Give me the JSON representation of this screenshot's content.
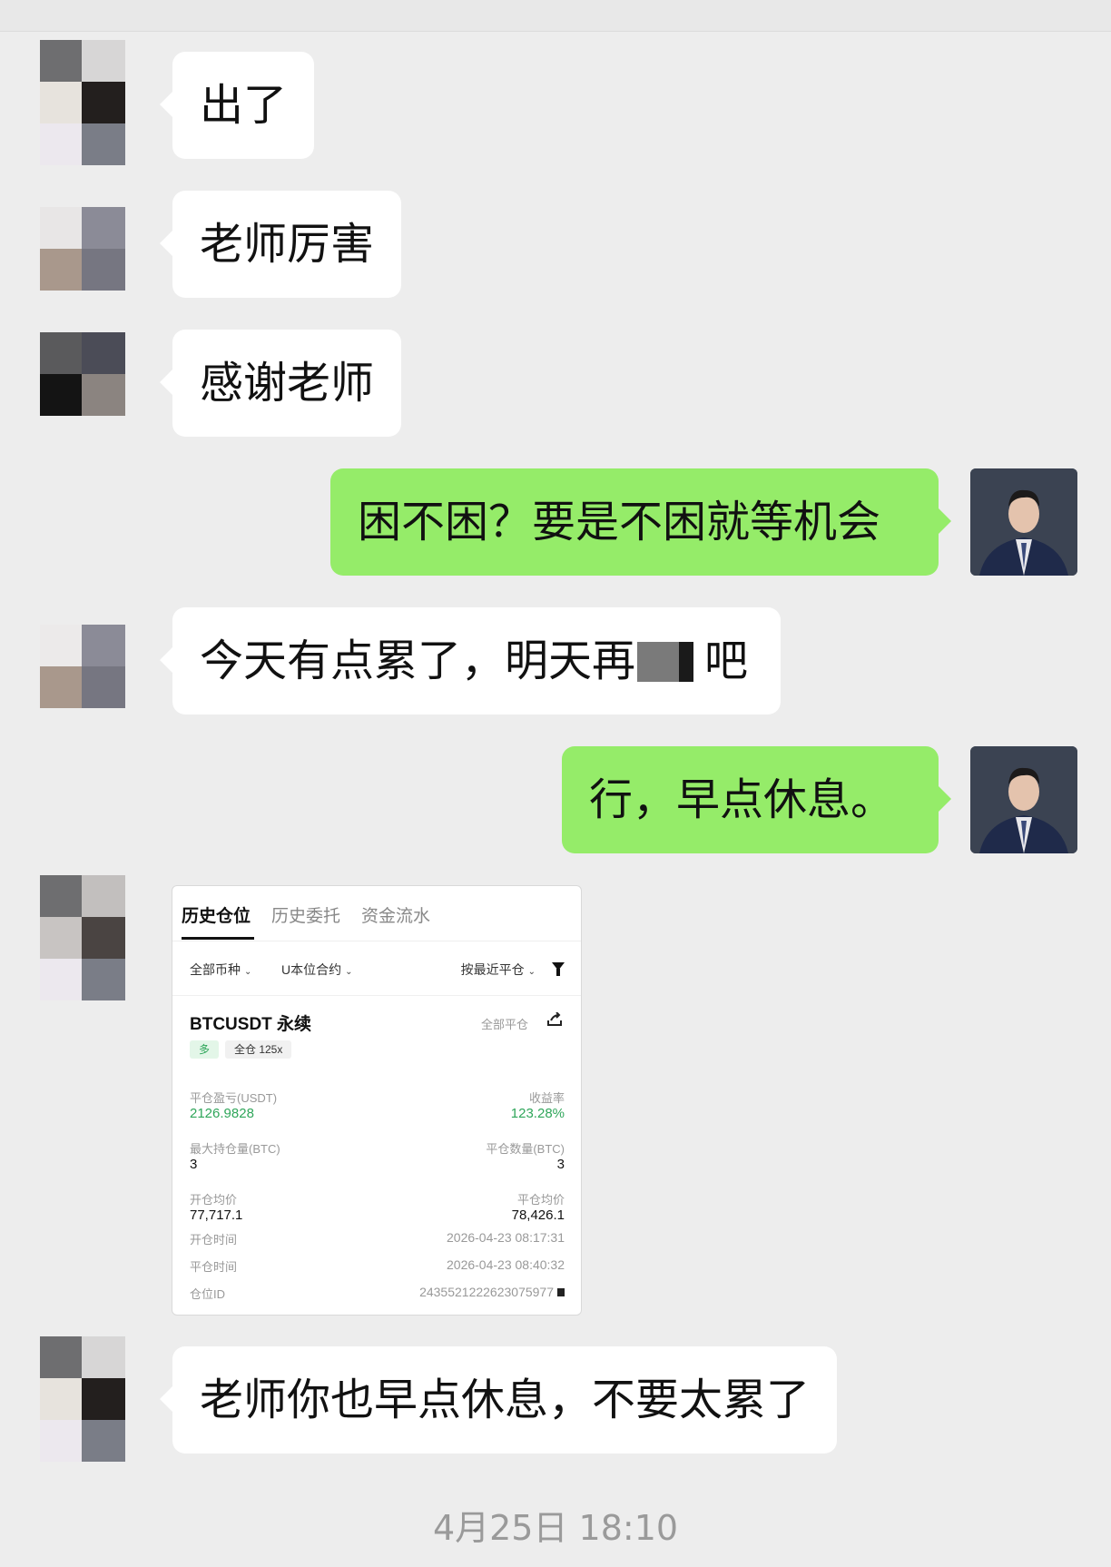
{
  "messages": [
    {
      "side": "left",
      "text": "出了"
    },
    {
      "side": "left",
      "text": "老师厉害"
    },
    {
      "side": "left",
      "text": "感谢老师"
    },
    {
      "side": "right",
      "text": "困不困？要是不困就等机会"
    },
    {
      "side": "left",
      "text_before": "今天有点累了，明天再",
      "text_after": "吧"
    },
    {
      "side": "right",
      "text": "行，早点休息。"
    },
    {
      "side": "left",
      "text": "老师你也早点休息，不要太累了"
    }
  ],
  "trade_card": {
    "tabs": [
      "历史仓位",
      "历史委托",
      "资金流水"
    ],
    "filters": {
      "coin": "全部币种",
      "contract": "U本位合约",
      "sort": "按最近平仓"
    },
    "symbol": "BTCUSDT 永续",
    "close_all": "全部平仓",
    "side_tag": "多",
    "mode_tag": "全仓 125x",
    "pnl_label": "平仓盈亏(USDT)",
    "pnl_value": "2126.9828",
    "roi_label": "收益率",
    "roi_value": "123.28%",
    "max_pos_label": "最大持仓量(BTC)",
    "max_pos_value": "3",
    "close_qty_label": "平仓数量(BTC)",
    "close_qty_value": "3",
    "open_avg_label": "开仓均价",
    "open_avg_value": "77,717.1",
    "close_avg_label": "平仓均价",
    "close_avg_value": "78,426.1",
    "open_time_label": "开仓时间",
    "open_time_value": "2026-04-23 08:17:31",
    "close_time_label": "平仓时间",
    "close_time_value": "2026-04-23 08:40:32",
    "pos_id_label": "仓位ID",
    "pos_id_value": "2435521222623075977"
  },
  "timestamp": "4月25日 18:10",
  "colors": {
    "background": "#ededed",
    "sent_bubble": "#95ec69",
    "received_bubble": "#ffffff",
    "profit_green": "#2fa65a"
  }
}
